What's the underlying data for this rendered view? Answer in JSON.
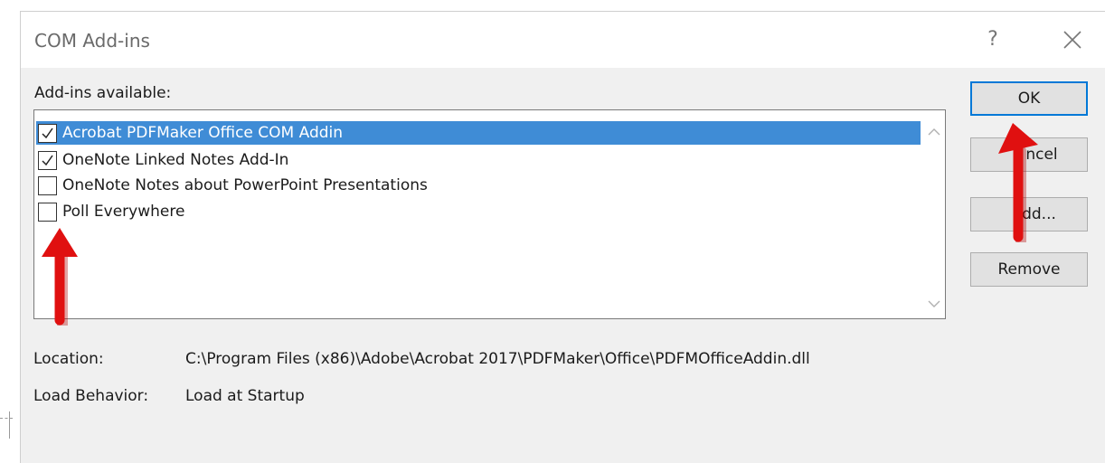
{
  "dialog": {
    "title": "COM Add-ins",
    "help_glyph": "?",
    "close_glyph": "✕"
  },
  "list": {
    "label": "Add-ins available:",
    "items": [
      {
        "label": "Acrobat PDFMaker Office COM Addin",
        "checked": true,
        "selected": true
      },
      {
        "label": "OneNote Linked Notes Add-In",
        "checked": true,
        "selected": false
      },
      {
        "label": "OneNote Notes about PowerPoint Presentations",
        "checked": false,
        "selected": false
      },
      {
        "label": "Poll Everywhere",
        "checked": false,
        "selected": false
      }
    ]
  },
  "buttons": {
    "ok": "OK",
    "cancel": "ncel",
    "add": "dd...",
    "remove": "Remove"
  },
  "details": {
    "location_label": "Location:",
    "location_value": "C:\\Program Files (x86)\\Adobe\\Acrobat 2017\\PDFMaker\\Office\\PDFMOfficeAddin.dll",
    "behavior_label": "Load Behavior:",
    "behavior_value": "Load at Startup"
  },
  "colors": {
    "selection": "#3f8cd6",
    "default_button_border": "#0078d7",
    "annotation_arrow": "#e01010"
  },
  "icons": {
    "scroll_up": "chevron-up-icon",
    "scroll_down": "chevron-down-icon",
    "checkmark": "checkmark-icon",
    "arrow": "red-arrow-annotation"
  }
}
